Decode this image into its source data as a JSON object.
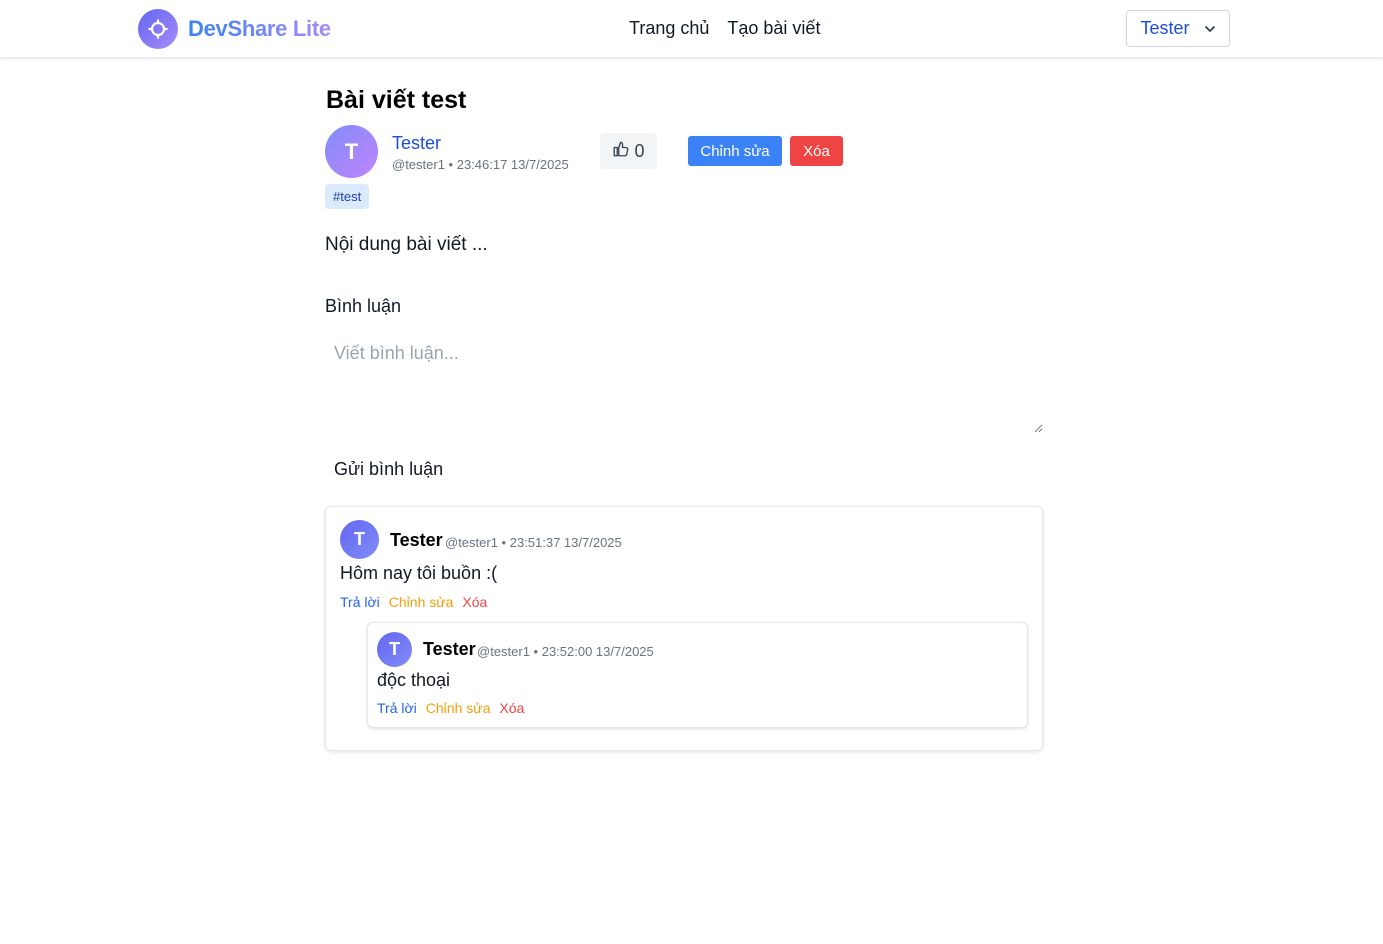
{
  "header": {
    "brand": "DevShare Lite",
    "nav": [
      {
        "label": "Trang chủ"
      },
      {
        "label": "Tạo bài viết"
      }
    ],
    "user": "Tester"
  },
  "post": {
    "title": "Bài viết test",
    "author_initial": "T",
    "author_name": "Tester",
    "author_meta": "@tester1 • 23:46:17 13/7/2025",
    "likes": "0",
    "edit_label": "Chỉnh sửa",
    "delete_label": "Xóa",
    "tag": "#test",
    "body": "Nội dung bài viết ..."
  },
  "comments_section": {
    "heading": "Bình luận",
    "placeholder": "Viết bình luận...",
    "submit_label": "Gửi bình luận"
  },
  "comments": [
    {
      "initial": "T",
      "name": "Tester",
      "meta": "@tester1 • 23:51:37 13/7/2025",
      "text": "Hôm nay tôi buồn :(",
      "actions": {
        "reply": "Trả lời",
        "edit": "Chỉnh sửa",
        "delete": "Xóa"
      },
      "replies": [
        {
          "initial": "T",
          "name": "Tester",
          "meta": "@tester1 • 23:52:00 13/7/2025",
          "text": "độc thoại",
          "actions": {
            "reply": "Trả lời",
            "edit": "Chỉnh sửa",
            "delete": "Xóa"
          }
        }
      ]
    }
  ],
  "colors": {
    "primary": "#3b82f6",
    "danger": "#ef4444",
    "warning": "#f59e0b",
    "link": "#1d4ed8"
  },
  "icons": [
    "logo-crosshair-icon",
    "chevron-down-icon",
    "thumbs-up-icon"
  ]
}
